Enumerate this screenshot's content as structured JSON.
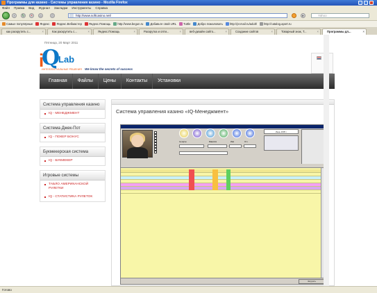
{
  "window": {
    "title": "Программы для казино - Системы управления казино - Mozilla Firefox"
  },
  "menu": [
    "Файл",
    "Правка",
    "Вид",
    "Журнал",
    "Закладки",
    "Инструменты",
    "Справка"
  ],
  "address": {
    "url": "http://www.softcasino.net/"
  },
  "search": {
    "placeholder": "Yahoo"
  },
  "bookmarks": [
    "Самые популярные",
    "Яндекс",
    "Яндекс.Вебмастер",
    "Яндекс.Помощь",
    "http://www.begun.ru",
    "Добавьте свой URL",
    "Tuttle",
    "Добро пожаловать",
    "http://pr.mail.ru/adult/",
    "http://catalog.aport.ru"
  ],
  "tabs": [
    {
      "label": "как раскрутить с...",
      "active": false
    },
    {
      "label": "Как раскрутить с...",
      "active": false
    },
    {
      "label": "Яндекс.Помощь",
      "active": false
    },
    {
      "label": "Раскрутка и опти...",
      "active": false
    },
    {
      "label": "веб-дизайн сайто...",
      "active": false
    },
    {
      "label": "Создание сайтов",
      "active": false
    },
    {
      "label": "Товарный знак, Т...",
      "active": false
    },
    {
      "label": "Программы дл...",
      "active": true
    }
  ],
  "page": {
    "date": "Пятница, 20 Март 2011",
    "logo": {
      "i": "i",
      "q": "Q",
      "lab": "Lab"
    },
    "tagline_sub": "ИНТЕЛЛЕКТУАЛЬНЫЕ РЕШЕНИЯ",
    "tagline_motto": "We know the secrets of success",
    "nav": [
      "Главная",
      "Файлы",
      "Цены",
      "Контакты",
      "Установки"
    ],
    "sidebar": [
      {
        "title": "Система управления казино",
        "links": [
          "IQ - МЕНЕДЖМЕНТ"
        ]
      },
      {
        "title": "Система Джек-Пот",
        "links": [
          "IQ - ПОКЕР БОНУС"
        ]
      },
      {
        "title": "Букмекерская система",
        "links": [
          "IQ - БУКМЕКЕР"
        ]
      },
      {
        "title": "Игровые системы",
        "links": [
          "ТАБЛО АМЕРИКАНСКОЙ РУЛЕТКИ",
          "IQ - СТАТИСТИКА РУЛЕТОК"
        ]
      }
    ],
    "main_title": "Система управления  казино «IQ-Менеджмент»",
    "screenshot": {
      "month": "Июнь 2005 г.",
      "fields": [
        "№ карты",
        "Фамилия",
        "Имя",
        "Отч."
      ],
      "footer_right": "Загрузить"
    }
  },
  "status": {
    "text": "Готово"
  },
  "colors": {
    "logo_blue": "#0d78c7",
    "logo_orange": "#f05a15",
    "link_red": "#cc2222",
    "nav_dark": "#2c2c2c"
  }
}
